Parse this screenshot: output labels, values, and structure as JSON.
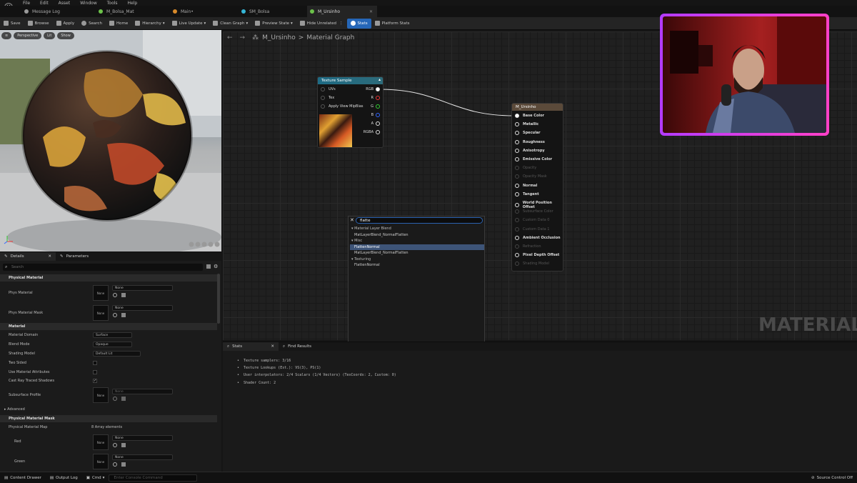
{
  "menu": [
    "File",
    "Edit",
    "Asset",
    "Window",
    "Tools",
    "Help"
  ],
  "tabs": [
    {
      "label": "Message Log",
      "color": "#9a9a9a"
    },
    {
      "label": "M_Bolsa_Mat",
      "color": "#6cc24a"
    },
    {
      "label": "Main•",
      "color": "#d88a2a"
    },
    {
      "label": "SM_Bolsa",
      "color": "#35b6d6"
    },
    {
      "label": "M_Ursinho",
      "color": "#6cc24a"
    }
  ],
  "toolbar": {
    "save": "Save",
    "browse": "Browse",
    "apply": "Apply",
    "search": "Search",
    "home": "Home",
    "hierarchy": "Hierarchy",
    "live_update": "Live Update",
    "clean_graph": "Clean Graph",
    "preview_state": "Preview State",
    "hide_unrelated": "Hide Unrelated",
    "stats": "Stats",
    "platform_stats": "Platform Stats"
  },
  "viewport": {
    "perspective": "Perspective",
    "lit": "Lit",
    "show": "Show"
  },
  "details": {
    "tab_details": "Details",
    "tab_parameters": "Parameters",
    "search_placeholder": "Search",
    "sec_physical_material": "Physical Material",
    "phys_material": "Phys Material",
    "phys_material_mask": "Phys Material Mask",
    "none": "None",
    "sec_material": "Material",
    "material_domain": "Material Domain",
    "material_domain_value": "Surface",
    "blend_mode": "Blend Mode",
    "blend_mode_value": "Opaque",
    "shading_model": "Shading Model",
    "shading_model_value": "Default Lit",
    "two_sided": "Two Sided",
    "use_material_attributes": "Use Material Attributes",
    "cast_ray_traced_shadows": "Cast Ray Traced Shadows",
    "subsurface_profile": "Subsurface Profile",
    "advanced": "Advanced",
    "sec_physical_material_mask": "Physical Material Mask",
    "physical_material_map": "Physical Material Map",
    "array_elements": "8 Array elements",
    "red": "Red",
    "green": "Green"
  },
  "graph": {
    "breadcrumb_asset": "M_Ursinho",
    "breadcrumb_sep": ">",
    "breadcrumb_graph": "Material Graph",
    "texture_node": {
      "title": "Texture Sample",
      "inputs": [
        "UVs",
        "Tex",
        "Apply View MipBias"
      ],
      "outputs": [
        "RGB",
        "R",
        "G",
        "B",
        "A",
        "RGBA"
      ]
    },
    "material_node": {
      "title": "M_Ursinho",
      "pins": [
        {
          "label": "Base Color",
          "enabled": true
        },
        {
          "label": "Metallic",
          "enabled": true
        },
        {
          "label": "Specular",
          "enabled": true
        },
        {
          "label": "Roughness",
          "enabled": true
        },
        {
          "label": "Anisotropy",
          "enabled": true
        },
        {
          "label": "Emissive Color",
          "enabled": true
        },
        {
          "label": "Opacity",
          "enabled": false
        },
        {
          "label": "Opacity Mask",
          "enabled": false
        },
        {
          "label": "Normal",
          "enabled": true
        },
        {
          "label": "Tangent",
          "enabled": true
        },
        {
          "label": "World Position Offset",
          "enabled": true
        },
        {
          "label": "Subsurface Color",
          "enabled": false
        },
        {
          "label": "Custom Data 0",
          "enabled": false
        },
        {
          "label": "Custom Data 1",
          "enabled": false
        },
        {
          "label": "Ambient Occlusion",
          "enabled": true
        },
        {
          "label": "Refraction",
          "enabled": false
        },
        {
          "label": "Pixel Depth Offset",
          "enabled": true
        },
        {
          "label": "Shading Model",
          "enabled": false
        }
      ]
    },
    "watermark": "MATERIAL"
  },
  "search_popup": {
    "query": "flatte",
    "items": [
      {
        "label": "Material Layer Blend",
        "type": "cat"
      },
      {
        "label": "MatLayerBlend_NormalFlatten",
        "type": "item"
      },
      {
        "label": "Misc",
        "type": "cat"
      },
      {
        "label": "FlattenNormal",
        "type": "sel"
      },
      {
        "label": "MatLayerBlend_NormalFlatten",
        "type": "item"
      },
      {
        "label": "Texturing",
        "type": "cat"
      },
      {
        "label": "FlattenNormal",
        "type": "item"
      }
    ]
  },
  "stats_panel": {
    "tab_stats": "Stats",
    "tab_find": "Find Results",
    "lines": [
      "Texture samplers: 3/16",
      "Texture Lookups (Est.): VS(3), PS(1)",
      "User interpolators: 2/4 Scalars (1/4 Vectors) (TexCoords: 2, Custom: 0)",
      "Shader Count: 2"
    ]
  },
  "statusbar": {
    "content_drawer": "Content Drawer",
    "output_log": "Output Log",
    "cmd": "Cmd",
    "console_placeholder": "Enter Console Command",
    "source_control": "Source Control Off"
  }
}
